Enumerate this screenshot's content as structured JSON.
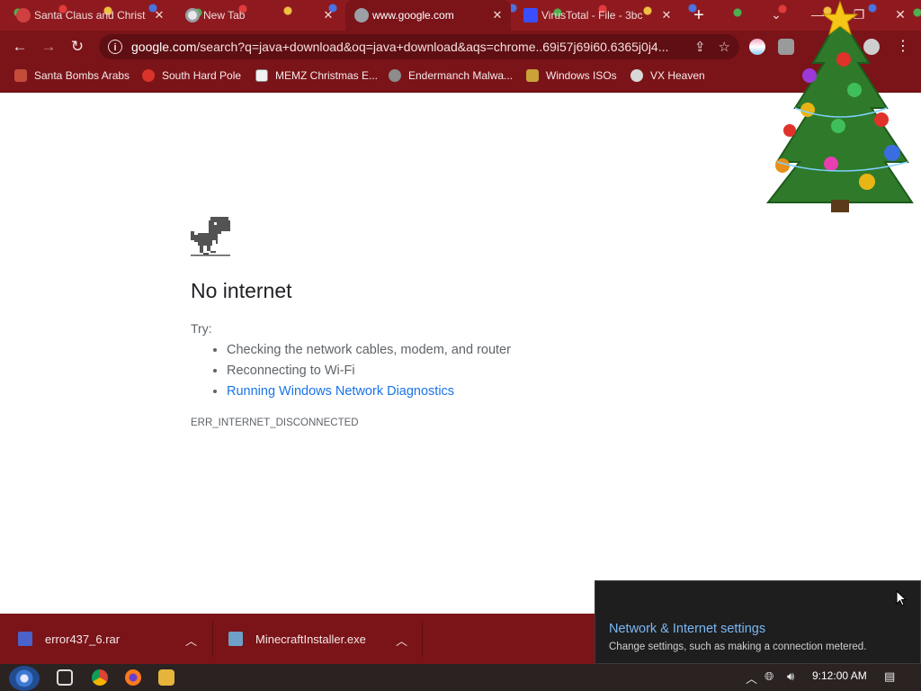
{
  "tabs": [
    {
      "title": "Santa Claus and Christ",
      "active": false,
      "color": "#d04040"
    },
    {
      "title": "New Tab",
      "active": false,
      "color": "#9aa0a6"
    },
    {
      "title": "www.google.com",
      "active": true,
      "color": "#9aa0a6"
    },
    {
      "title": "VirusTotal - File - 3bc",
      "active": false,
      "color": "#394eff"
    }
  ],
  "toolbar": {
    "url_host": "google.com",
    "url_rest": "/search?q=java+download&oq=java+download&aqs=chrome..69i57j69i60.6365j0j4..."
  },
  "bookmarks": [
    {
      "label": "Santa Bombs Arabs",
      "color": "#c44d3a"
    },
    {
      "label": "South Hard Pole",
      "color": "#d9342b"
    },
    {
      "label": "MEMZ Christmas E...",
      "color": "#f2f2f2"
    },
    {
      "label": "Endermanch Malwa...",
      "color": "#8d8d8d"
    },
    {
      "label": "Windows ISOs",
      "color": "#c9a23a"
    },
    {
      "label": "VX Heaven",
      "color": "#d8d8d8"
    }
  ],
  "error": {
    "title": "No internet",
    "try_label": "Try:",
    "suggestions": [
      "Checking the network cables, modem, and router",
      "Reconnecting to Wi-Fi"
    ],
    "diagnostics_link": "Running Windows Network Diagnostics",
    "code": "ERR_INTERNET_DISCONNECTED"
  },
  "downloads": [
    {
      "name": "error437_6.rar",
      "icon_color": "#4a62c9"
    },
    {
      "name": "MinecraftInstaller.exe",
      "icon_color": "#6fa0c8"
    }
  ],
  "network_popup": {
    "title": "Network & Internet settings",
    "subtitle": "Change settings, such as making a connection metered."
  },
  "taskbar": {
    "clock": "9:12:00 AM"
  },
  "colors": {
    "theme": "#7a1419",
    "link": "#1a73e8"
  }
}
